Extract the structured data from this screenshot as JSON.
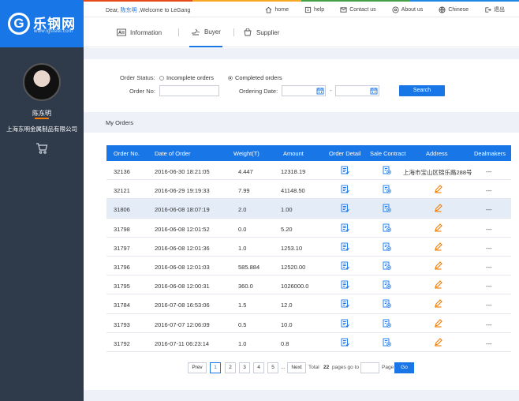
{
  "colors": {
    "brand": "#1976e6",
    "sidebar": "#2f3a4a",
    "accent": "#f57c00"
  },
  "strip_colors": [
    "#e64a19",
    "#f9a825",
    "#43a047",
    "#1e88e5"
  ],
  "logo": {
    "mark": "G",
    "name": "乐钢网",
    "url": "www.lgsteel.com"
  },
  "user": {
    "name": "陈东明",
    "company": "上海东明金属制品有限公司"
  },
  "header": {
    "greeting_prefix": "Dear,",
    "greeting_user": "陈东明",
    "greeting_suffix": ",Welcome to LeGang",
    "links": [
      {
        "label": "home",
        "icon": "home-icon"
      },
      {
        "label": "help",
        "icon": "help-icon"
      },
      {
        "label": "Contact us",
        "icon": "contact-icon"
      },
      {
        "label": "About us",
        "icon": "about-icon"
      },
      {
        "label": "Chinese",
        "icon": "globe-icon"
      },
      {
        "label": "退出",
        "icon": "logout-icon"
      }
    ]
  },
  "nav": {
    "tabs": [
      {
        "label": "Information",
        "icon": "information-icon"
      },
      {
        "label": "Buyer",
        "icon": "buyer-icon",
        "active": true
      },
      {
        "label": "Supplier",
        "icon": "supplier-icon"
      }
    ]
  },
  "filter": {
    "status_label": "Order Status:",
    "options": [
      {
        "label": "Incomplete orders",
        "selected": false
      },
      {
        "label": "Completed orders",
        "selected": true
      }
    ],
    "order_no_label": "Order No:",
    "order_no_value": "",
    "date_label": "Ordering Date:",
    "date_from": "",
    "date_to": "",
    "date_sep": "-",
    "search_label": "Search"
  },
  "section_title": "My Orders",
  "table": {
    "columns": [
      "Order No.",
      "Date of Order",
      "Weight(T)",
      "Amount",
      "Order Detail",
      "Sale Contract",
      "Address",
      "Dealmakers"
    ],
    "rows": [
      {
        "order_no": "32136",
        "date": "2016-06-30 18:21:05",
        "weight": "4.447",
        "amount": "12318.19",
        "address": "上海市宝山区锦乐路288号",
        "dealmakers": "---"
      },
      {
        "order_no": "32121",
        "date": "2016-06-29 19:19:33",
        "weight": "7.99",
        "amount": "41148.50",
        "address": "",
        "dealmakers": "---"
      },
      {
        "order_no": "31806",
        "date": "2016-06-08 18:07:19",
        "weight": "2.0",
        "amount": "1.00",
        "address": "",
        "dealmakers": "---"
      },
      {
        "order_no": "31798",
        "date": "2016-06-08 12:01:52",
        "weight": "0.0",
        "amount": "5.20",
        "address": "",
        "dealmakers": "---"
      },
      {
        "order_no": "31797",
        "date": "2016-06-08 12:01:36",
        "weight": "1.0",
        "amount": "1253.10",
        "address": "",
        "dealmakers": "---"
      },
      {
        "order_no": "31796",
        "date": "2016-06-08 12:01:03",
        "weight": "585.884",
        "amount": "12520.00",
        "address": "",
        "dealmakers": "---"
      },
      {
        "order_no": "31795",
        "date": "2016-06-08 12:00:31",
        "weight": "360.0",
        "amount": "1026000.0",
        "address": "",
        "dealmakers": "---"
      },
      {
        "order_no": "31784",
        "date": "2016-07-08 16:53:06",
        "weight": "1.5",
        "amount": "12.0",
        "address": "",
        "dealmakers": "---"
      },
      {
        "order_no": "31793",
        "date": "2016-07-07 12:06:09",
        "weight": "0.5",
        "amount": "10.0",
        "address": "",
        "dealmakers": "---"
      },
      {
        "order_no": "31792",
        "date": "2016-07-11 06:23:14",
        "weight": "1.0",
        "amount": "0.8",
        "address": "",
        "dealmakers": "---"
      }
    ],
    "highlight_row": 2
  },
  "pagination": {
    "prev": "Prev",
    "pages": [
      "1",
      "2",
      "3",
      "4",
      "5"
    ],
    "current": "1",
    "ellipsis": "...",
    "next": "Next",
    "total_label": "Total",
    "total_pages": "22",
    "pages_go_label": "pages go to",
    "goto_value": "",
    "page_label": "Page",
    "go": "Go"
  }
}
